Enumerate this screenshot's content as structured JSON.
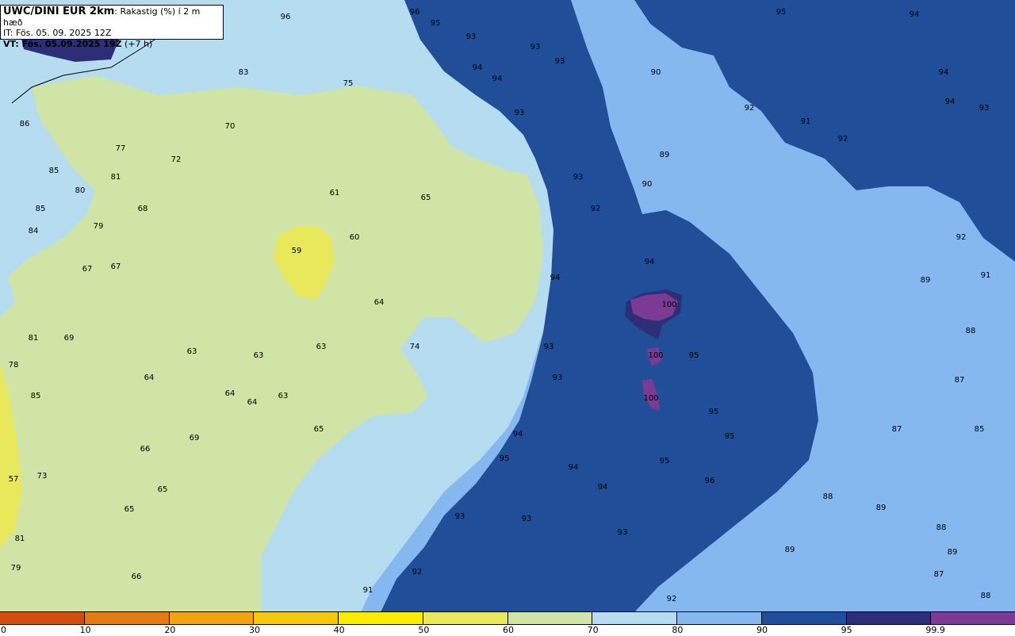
{
  "header": {
    "model": "UWC/DINI EUR 2km",
    "variable": ": Rakastig (%) í 2 m hæð",
    "init_time": "IT: Fös. 05. 09. 2025 12Z",
    "valid_time": "VT: Fös. 05.09.2025 19Z",
    "lead": " (+7 h)"
  },
  "colors": {
    "c60_70": "#d0e4a6",
    "c50_60": "#e8e85a",
    "c70_80": "#b6dcf0",
    "c80_90": "#86b8f0",
    "c90_95": "#204e98",
    "c95_99": "#2c2f78",
    "c99": "#7b3a93"
  },
  "colorbar": {
    "segment_colors": [
      "#d14e0f",
      "#e37a12",
      "#f2a312",
      "#f7c710",
      "#fcec00",
      "#e8e85a",
      "#d0e4a6",
      "#b6dcf0",
      "#86b8f0",
      "#204e98",
      "#2c2f78",
      "#7b3a93"
    ],
    "tick_labels": [
      "0",
      "10",
      "20",
      "30",
      "40",
      "50",
      "60",
      "70",
      "80",
      "90",
      "95",
      "99.9"
    ]
  },
  "map_labels": [
    "96",
    "96",
    "95",
    "93",
    "93",
    "93",
    "94",
    "94",
    "93",
    "95",
    "94",
    "90",
    "92",
    "91",
    "92",
    "94",
    "93",
    "94",
    "93",
    "92",
    "89",
    "90",
    "83",
    "75",
    "70",
    "86",
    "77",
    "72",
    "85",
    "81",
    "80",
    "61",
    "65",
    "85",
    "68",
    "79",
    "84",
    "60",
    "59",
    "67",
    "67",
    "64",
    "92",
    "94",
    "91",
    "89",
    "94",
    "100",
    "88",
    "81",
    "69",
    "63",
    "63",
    "63",
    "74",
    "93",
    "100",
    "95",
    "78",
    "64",
    "85",
    "64",
    "64",
    "63",
    "93",
    "87",
    "100",
    "95",
    "65",
    "95",
    "87",
    "85",
    "94",
    "69",
    "66",
    "95",
    "94",
    "73",
    "57",
    "94",
    "95",
    "96",
    "65",
    "88",
    "65",
    "89",
    "93",
    "93",
    "88",
    "81",
    "89",
    "89",
    "79",
    "93",
    "87",
    "92",
    "66",
    "91",
    "92",
    "88"
  ]
}
